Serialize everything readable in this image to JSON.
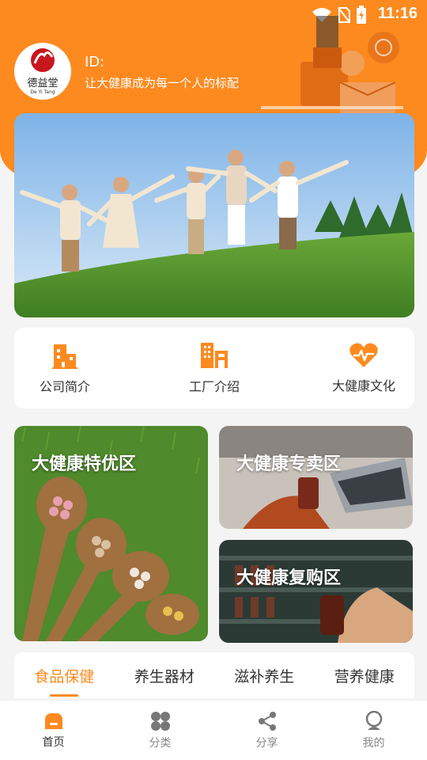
{
  "status": {
    "time": "11:16"
  },
  "profile": {
    "id_label": "ID:",
    "slogan": "让大健康成为每一个人的标配",
    "logo_text": "德益堂",
    "logo_sub": "De Yi Tang"
  },
  "quick_nav": [
    {
      "label": "公司简介",
      "icon": "building-icon"
    },
    {
      "label": "工厂介绍",
      "icon": "factory-icon"
    },
    {
      "label": "大健康文化",
      "icon": "heart-pulse-icon"
    }
  ],
  "zones": {
    "zone1": "大健康特优区",
    "zone2": "大健康专卖区",
    "zone3": "大健康复购区"
  },
  "category_tabs": [
    {
      "label": "食品保健",
      "active": true
    },
    {
      "label": "养生器材"
    },
    {
      "label": "滋补养生"
    },
    {
      "label": "营养健康"
    }
  ],
  "bottom_nav": [
    {
      "label": "首页",
      "icon": "home-icon",
      "active": true
    },
    {
      "label": "分类",
      "icon": "grid-icon"
    },
    {
      "label": "分享",
      "icon": "share-icon"
    },
    {
      "label": "我的",
      "icon": "user-icon"
    }
  ],
  "colors": {
    "accent": "#fd8a1f"
  }
}
